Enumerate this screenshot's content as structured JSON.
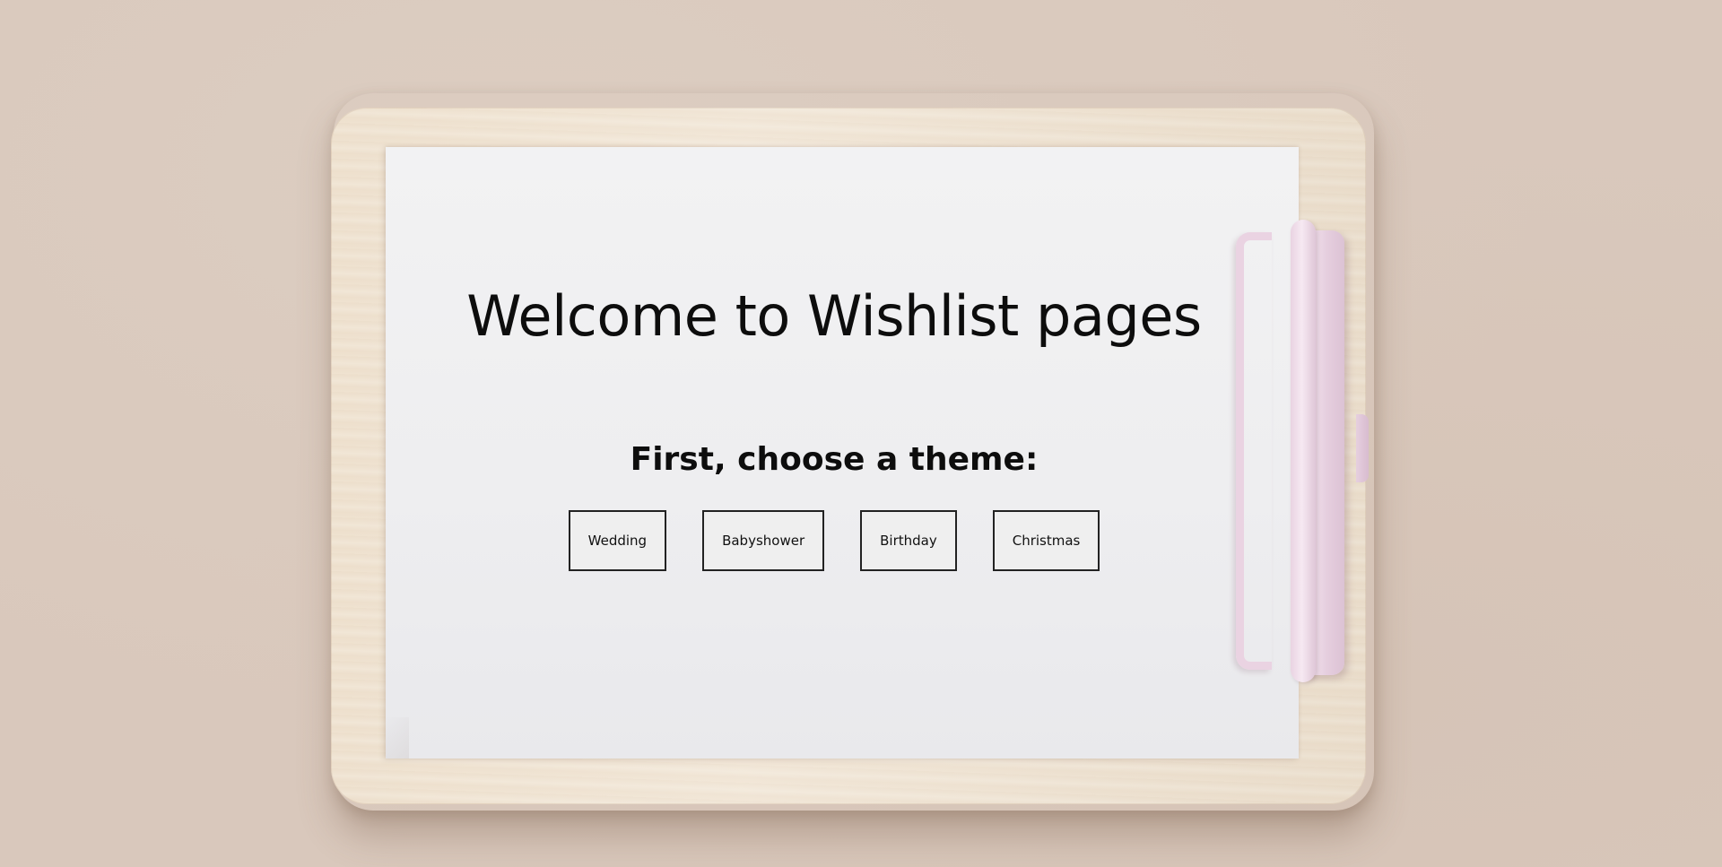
{
  "page": {
    "title": "Welcome to Wishlist pages",
    "subtitle": "First, choose a theme:"
  },
  "themes": {
    "buttons": [
      {
        "label": "Wedding"
      },
      {
        "label": "Babyshower"
      },
      {
        "label": "Birthday"
      },
      {
        "label": "Christmas"
      }
    ]
  },
  "colors": {
    "background": "#d9c8bc",
    "clipboard_wood": "#efe3d2",
    "paper": "#eeeef0",
    "clip_pink": "#ead3e2",
    "text": "#0d0d0d",
    "button_background": "#efefef",
    "button_border": "#222222"
  },
  "icons": {
    "clipboard": "clipboard-illustration",
    "clip": "binder-clip-icon"
  }
}
